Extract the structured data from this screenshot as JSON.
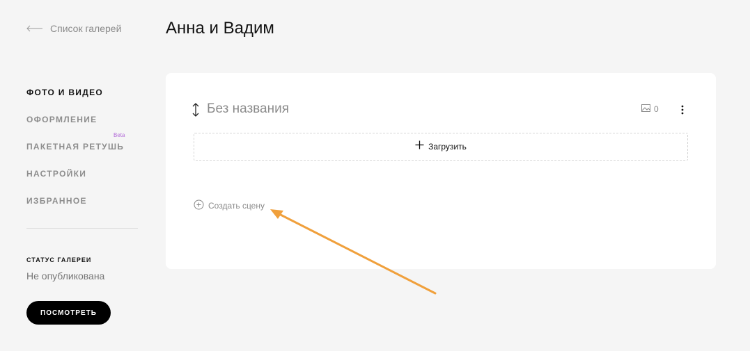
{
  "header": {
    "back_label": "Список галерей",
    "title": "Анна и Вадим"
  },
  "sidebar": {
    "items": [
      {
        "label": "ФОТО И ВИДЕО",
        "active": true
      },
      {
        "label": "ОФОРМЛЕНИЕ",
        "active": false
      },
      {
        "label": "ПАКЕТНАЯ РЕТУШЬ",
        "active": false,
        "badge": "Beta"
      },
      {
        "label": "НАСТРОЙКИ",
        "active": false
      },
      {
        "label": "ИЗБРАННОЕ",
        "active": false
      }
    ],
    "status_label": "СТАТУС ГАЛЕРЕИ",
    "status_value": "Не опубликована",
    "view_button_label": "ПОСМОТРЕТЬ"
  },
  "scene": {
    "title": "Без названия",
    "photo_count": "0",
    "upload_label": "Загрузить",
    "create_scene_label": "Создать сцену"
  },
  "colors": {
    "background": "#f5f5f5",
    "card": "#ffffff",
    "primary_button": "#000000",
    "beta_badge": "#b26ad8",
    "annotation_arrow": "#f0a03c"
  },
  "icons": {
    "back": "arrow-left-icon",
    "drag": "vertical-resize-icon",
    "photos": "image-icon",
    "more": "more-vertical-icon",
    "upload": "plus-icon",
    "create": "plus-circle-icon"
  }
}
